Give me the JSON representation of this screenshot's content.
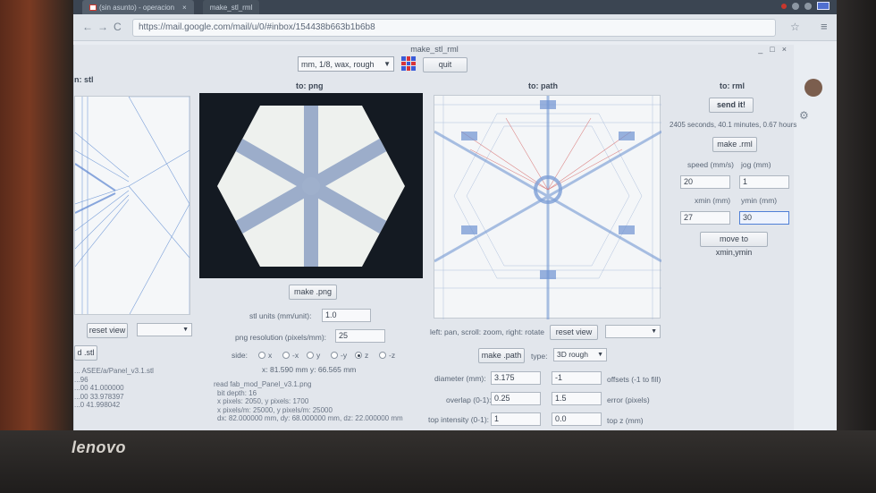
{
  "os": {
    "tab_label": "(sin asunto) - operacion",
    "tab_close": "×",
    "tab2_label": "make_stl_rml"
  },
  "browser": {
    "back": "←",
    "forward": "→",
    "reload": "C",
    "url": "https://mail.google.com/mail/u/0/#inbox/154438b663b1b6b8",
    "star": "☆",
    "menu": "≡"
  },
  "app": {
    "title": "make_stl_rml",
    "win_controls": [
      "_",
      "□",
      "×"
    ],
    "mode_select": "mm, 1/8, wax, rough",
    "quit_label": "quit",
    "colors": {
      "grid_icon": [
        "#3b5bd8",
        "#d8343a",
        "#3b5bd8",
        "#d8343a",
        "#3b5bd8",
        "#d8343a",
        "#3b5bd8",
        "#d8343a",
        "#3b5bd8"
      ]
    }
  },
  "stl_panel": {
    "heading": "n: stl",
    "reset_view": "reset view",
    "view_select": "",
    "load_button": "d .stl",
    "info_lines": [
      "... ASEE/a/Panel_v3.1.stl",
      "...96",
      "...00 41.000000",
      "...00 33.978397",
      "...0 41.998042"
    ]
  },
  "png_panel": {
    "heading": "to: png",
    "make_png": "make .png",
    "units_label": "stl units (mm/unit):",
    "units_value": "1.0",
    "resolution_label": "png resolution (pixels/mm):",
    "resolution_value": "25",
    "side_label": "side:",
    "side_options": [
      "x",
      "-x",
      "y",
      "-y",
      "z",
      "-z"
    ],
    "side_selected": "z",
    "cursor_readout": "x: 81.590 mm  y: 66.565 mm",
    "info_lines": [
      "read fab_mod_Panel_v3.1.png",
      "bit depth: 16",
      "x pixels: 2050, y pixels: 1700",
      "x pixels/m: 25000, y pixels/m: 25000",
      "dx: 82.000000 mm, dy: 68.000000 mm, dz: 22.000000 mm"
    ]
  },
  "path_panel": {
    "heading": "to: path",
    "help_text": "left: pan, scroll: zoom, right: rotate",
    "reset_view": "reset view",
    "view_select": "",
    "make_path": "make .path",
    "type_label": "type:",
    "type_value": "3D rough",
    "diameter_label": "diameter (mm):",
    "diameter_value": "3.175",
    "offsets_value": "-1",
    "offsets_label": "offsets (-1 to fill)",
    "overlap_label": "overlap (0-1):",
    "overlap_value": "0.25",
    "error_value": "1.5",
    "error_label": "error (pixels)",
    "top_intensity_label": "top intensity (0-1):",
    "top_intensity_value": "1",
    "top_z_value": "0.0",
    "top_z_label": "top z (mm)"
  },
  "rml_panel": {
    "heading": "to: rml",
    "send_label": "send it!",
    "timing": "2405 seconds, 40.1 minutes, 0.67 hours",
    "make_rml": "make .rml",
    "speed_label": "speed (mm/s)",
    "jog_label": "jog (mm)",
    "speed_value": "20",
    "jog_value": "1",
    "xmin_label": "xmin (mm)",
    "ymin_label": "ymin (mm)",
    "xmin_value": "27",
    "ymin_value": "30",
    "move_button": "move to xmin,ymin"
  },
  "laptop": {
    "brand": "lenovo"
  }
}
